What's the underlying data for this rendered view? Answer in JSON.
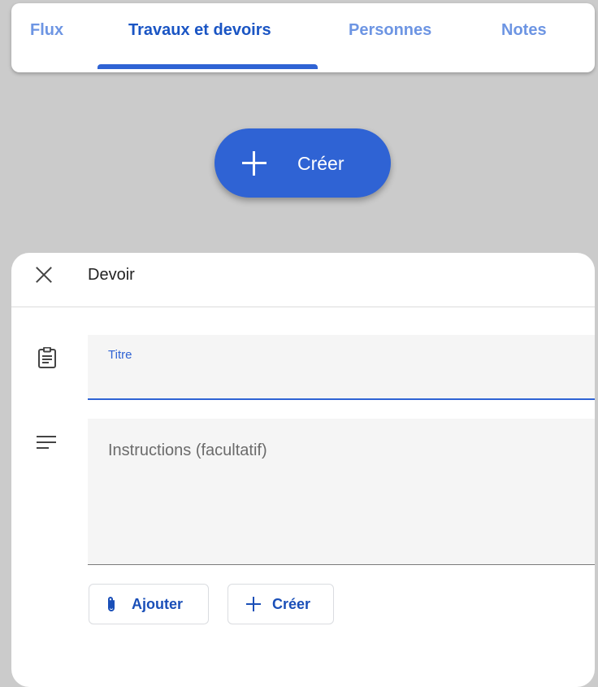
{
  "tabs": [
    {
      "label": "Flux",
      "active": false
    },
    {
      "label": "Travaux et devoirs",
      "active": true
    },
    {
      "label": "Personnes",
      "active": false
    },
    {
      "label": "Notes",
      "active": false
    }
  ],
  "fab": {
    "label": "Créer",
    "icon": "plus-icon"
  },
  "dialog": {
    "title": "Devoir",
    "close_icon": "close-icon",
    "title_field": {
      "label": "Titre",
      "value": ""
    },
    "instructions_field": {
      "placeholder": "Instructions (facultatif)",
      "value": ""
    },
    "buttons": {
      "add": {
        "label": "Ajouter",
        "icon": "paperclip-icon"
      },
      "create": {
        "label": "Créer",
        "icon": "plus-icon"
      }
    }
  },
  "colors": {
    "accent": "#2f63d4",
    "tab_active": "#1a55c4",
    "tab_inactive": "#6d95e3",
    "background": "#cbcbcb"
  }
}
